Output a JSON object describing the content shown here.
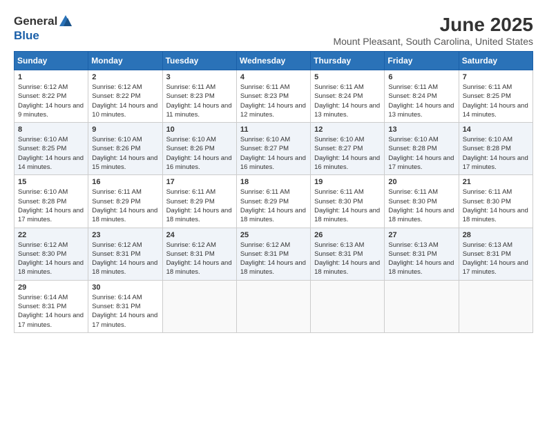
{
  "header": {
    "logo_general": "General",
    "logo_blue": "Blue",
    "month_title": "June 2025",
    "location": "Mount Pleasant, South Carolina, United States"
  },
  "days_of_week": [
    "Sunday",
    "Monday",
    "Tuesday",
    "Wednesday",
    "Thursday",
    "Friday",
    "Saturday"
  ],
  "weeks": [
    [
      {
        "day": "1",
        "sunrise": "Sunrise: 6:12 AM",
        "sunset": "Sunset: 8:22 PM",
        "daylight": "Daylight: 14 hours and 9 minutes."
      },
      {
        "day": "2",
        "sunrise": "Sunrise: 6:12 AM",
        "sunset": "Sunset: 8:22 PM",
        "daylight": "Daylight: 14 hours and 10 minutes."
      },
      {
        "day": "3",
        "sunrise": "Sunrise: 6:11 AM",
        "sunset": "Sunset: 8:23 PM",
        "daylight": "Daylight: 14 hours and 11 minutes."
      },
      {
        "day": "4",
        "sunrise": "Sunrise: 6:11 AM",
        "sunset": "Sunset: 8:23 PM",
        "daylight": "Daylight: 14 hours and 12 minutes."
      },
      {
        "day": "5",
        "sunrise": "Sunrise: 6:11 AM",
        "sunset": "Sunset: 8:24 PM",
        "daylight": "Daylight: 14 hours and 13 minutes."
      },
      {
        "day": "6",
        "sunrise": "Sunrise: 6:11 AM",
        "sunset": "Sunset: 8:24 PM",
        "daylight": "Daylight: 14 hours and 13 minutes."
      },
      {
        "day": "7",
        "sunrise": "Sunrise: 6:11 AM",
        "sunset": "Sunset: 8:25 PM",
        "daylight": "Daylight: 14 hours and 14 minutes."
      }
    ],
    [
      {
        "day": "8",
        "sunrise": "Sunrise: 6:10 AM",
        "sunset": "Sunset: 8:25 PM",
        "daylight": "Daylight: 14 hours and 14 minutes."
      },
      {
        "day": "9",
        "sunrise": "Sunrise: 6:10 AM",
        "sunset": "Sunset: 8:26 PM",
        "daylight": "Daylight: 14 hours and 15 minutes."
      },
      {
        "day": "10",
        "sunrise": "Sunrise: 6:10 AM",
        "sunset": "Sunset: 8:26 PM",
        "daylight": "Daylight: 14 hours and 16 minutes."
      },
      {
        "day": "11",
        "sunrise": "Sunrise: 6:10 AM",
        "sunset": "Sunset: 8:27 PM",
        "daylight": "Daylight: 14 hours and 16 minutes."
      },
      {
        "day": "12",
        "sunrise": "Sunrise: 6:10 AM",
        "sunset": "Sunset: 8:27 PM",
        "daylight": "Daylight: 14 hours and 16 minutes."
      },
      {
        "day": "13",
        "sunrise": "Sunrise: 6:10 AM",
        "sunset": "Sunset: 8:28 PM",
        "daylight": "Daylight: 14 hours and 17 minutes."
      },
      {
        "day": "14",
        "sunrise": "Sunrise: 6:10 AM",
        "sunset": "Sunset: 8:28 PM",
        "daylight": "Daylight: 14 hours and 17 minutes."
      }
    ],
    [
      {
        "day": "15",
        "sunrise": "Sunrise: 6:10 AM",
        "sunset": "Sunset: 8:28 PM",
        "daylight": "Daylight: 14 hours and 17 minutes."
      },
      {
        "day": "16",
        "sunrise": "Sunrise: 6:11 AM",
        "sunset": "Sunset: 8:29 PM",
        "daylight": "Daylight: 14 hours and 18 minutes."
      },
      {
        "day": "17",
        "sunrise": "Sunrise: 6:11 AM",
        "sunset": "Sunset: 8:29 PM",
        "daylight": "Daylight: 14 hours and 18 minutes."
      },
      {
        "day": "18",
        "sunrise": "Sunrise: 6:11 AM",
        "sunset": "Sunset: 8:29 PM",
        "daylight": "Daylight: 14 hours and 18 minutes."
      },
      {
        "day": "19",
        "sunrise": "Sunrise: 6:11 AM",
        "sunset": "Sunset: 8:30 PM",
        "daylight": "Daylight: 14 hours and 18 minutes."
      },
      {
        "day": "20",
        "sunrise": "Sunrise: 6:11 AM",
        "sunset": "Sunset: 8:30 PM",
        "daylight": "Daylight: 14 hours and 18 minutes."
      },
      {
        "day": "21",
        "sunrise": "Sunrise: 6:11 AM",
        "sunset": "Sunset: 8:30 PM",
        "daylight": "Daylight: 14 hours and 18 minutes."
      }
    ],
    [
      {
        "day": "22",
        "sunrise": "Sunrise: 6:12 AM",
        "sunset": "Sunset: 8:30 PM",
        "daylight": "Daylight: 14 hours and 18 minutes."
      },
      {
        "day": "23",
        "sunrise": "Sunrise: 6:12 AM",
        "sunset": "Sunset: 8:31 PM",
        "daylight": "Daylight: 14 hours and 18 minutes."
      },
      {
        "day": "24",
        "sunrise": "Sunrise: 6:12 AM",
        "sunset": "Sunset: 8:31 PM",
        "daylight": "Daylight: 14 hours and 18 minutes."
      },
      {
        "day": "25",
        "sunrise": "Sunrise: 6:12 AM",
        "sunset": "Sunset: 8:31 PM",
        "daylight": "Daylight: 14 hours and 18 minutes."
      },
      {
        "day": "26",
        "sunrise": "Sunrise: 6:13 AM",
        "sunset": "Sunset: 8:31 PM",
        "daylight": "Daylight: 14 hours and 18 minutes."
      },
      {
        "day": "27",
        "sunrise": "Sunrise: 6:13 AM",
        "sunset": "Sunset: 8:31 PM",
        "daylight": "Daylight: 14 hours and 18 minutes."
      },
      {
        "day": "28",
        "sunrise": "Sunrise: 6:13 AM",
        "sunset": "Sunset: 8:31 PM",
        "daylight": "Daylight: 14 hours and 17 minutes."
      }
    ],
    [
      {
        "day": "29",
        "sunrise": "Sunrise: 6:14 AM",
        "sunset": "Sunset: 8:31 PM",
        "daylight": "Daylight: 14 hours and 17 minutes."
      },
      {
        "day": "30",
        "sunrise": "Sunrise: 6:14 AM",
        "sunset": "Sunset: 8:31 PM",
        "daylight": "Daylight: 14 hours and 17 minutes."
      },
      {
        "day": "",
        "sunrise": "",
        "sunset": "",
        "daylight": ""
      },
      {
        "day": "",
        "sunrise": "",
        "sunset": "",
        "daylight": ""
      },
      {
        "day": "",
        "sunrise": "",
        "sunset": "",
        "daylight": ""
      },
      {
        "day": "",
        "sunrise": "",
        "sunset": "",
        "daylight": ""
      },
      {
        "day": "",
        "sunrise": "",
        "sunset": "",
        "daylight": ""
      }
    ]
  ]
}
